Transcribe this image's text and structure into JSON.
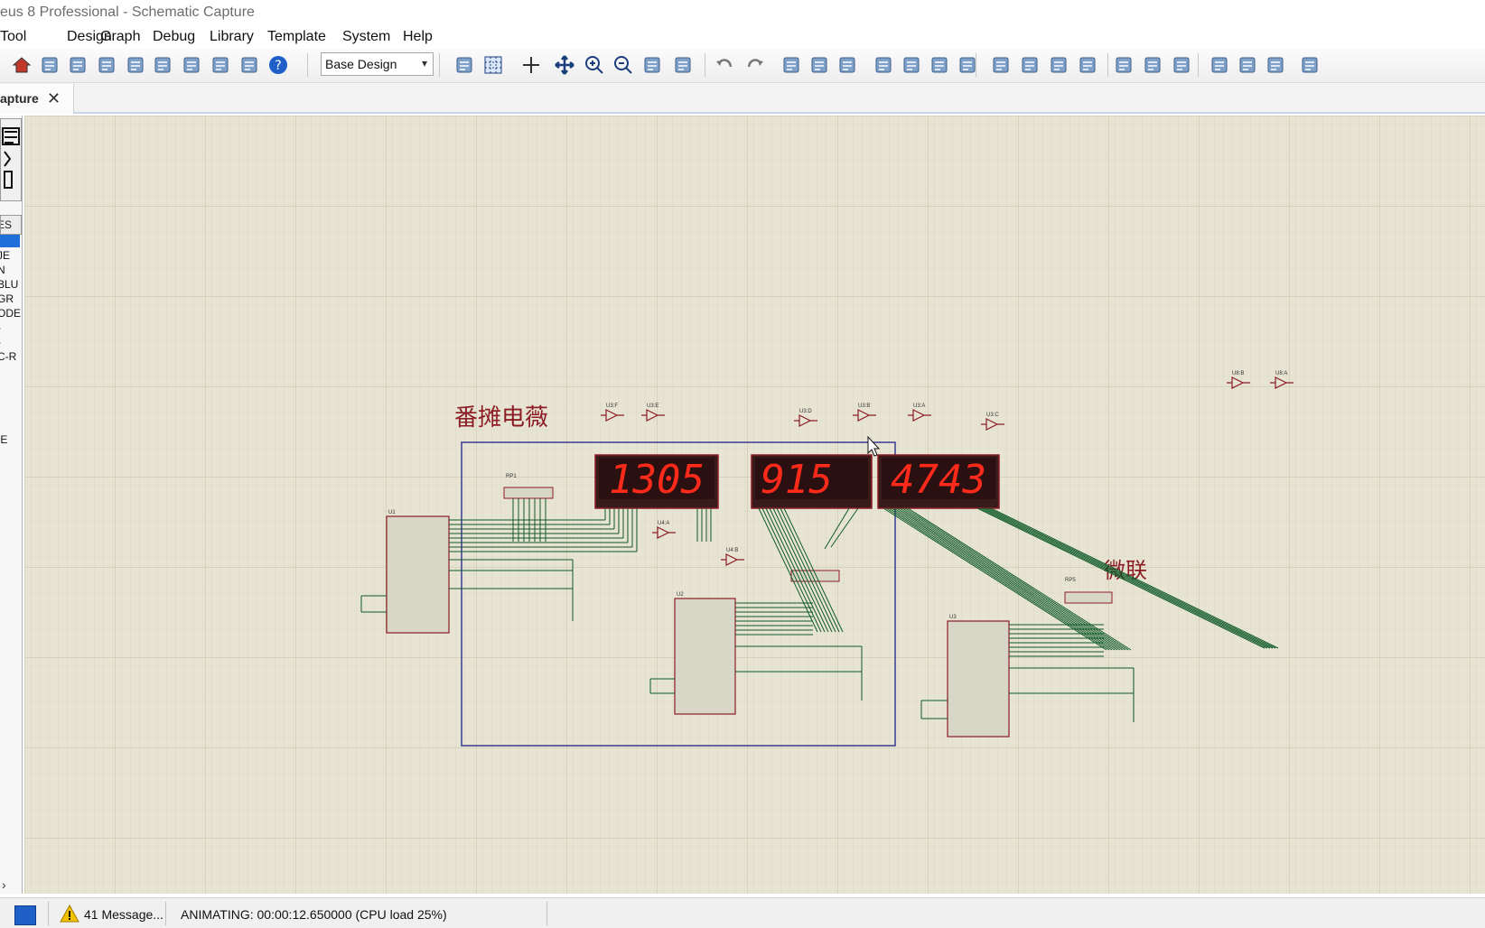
{
  "window": {
    "title": "eus 8 Professional - Schematic Capture"
  },
  "menu": {
    "items": [
      "Tool",
      "Design",
      "Graph",
      "Debug",
      "Library",
      "Template",
      "System",
      "Help"
    ]
  },
  "toolbar": {
    "layer_value": "Base Design",
    "icons": [
      "home-icon",
      "schematic-icon",
      "pcb-icon",
      "gerber-icon",
      "3d-viewer-icon",
      "bom-icon",
      "design-explorer-icon",
      "vsm-studio-icon",
      "notes-icon",
      "help-icon",
      "refresh-icon",
      "grid-icon",
      "origin-icon",
      "pan-icon",
      "zoom-in-icon",
      "zoom-out-icon",
      "zoom-all-icon",
      "zoom-area-icon",
      "undo-icon",
      "redo-icon",
      "cut-icon",
      "copy-icon",
      "paste-icon",
      "block-copy-icon",
      "block-move-icon",
      "block-rotate-icon",
      "block-delete-icon",
      "pick-device-icon",
      "make-device-icon",
      "packaging-tool-icon",
      "decompose-icon",
      "wire-autorouter-icon",
      "search-tag-icon",
      "property-assign-icon",
      "new-sheet-icon",
      "remove-sheet-icon",
      "exit-parent-icon",
      "electrical-rule-check-icon"
    ]
  },
  "tab": {
    "label": "apture",
    "close": "✕"
  },
  "left_panel": {
    "header": "ES",
    "items": [
      "JE",
      "N",
      "BLU",
      "GR",
      "ODE",
      "-",
      "-",
      "C-R",
      "IE"
    ],
    "scroll_arrow": "›"
  },
  "schematic": {
    "label_left": "番摊电薇",
    "label_right": "微联",
    "displays": [
      {
        "digits": "1305"
      },
      {
        "digits": "915"
      },
      {
        "digits": "4743"
      }
    ],
    "chip_labels": [
      "U1",
      "U2",
      "U3"
    ],
    "rp_labels": [
      "RP1",
      "RP5"
    ],
    "gate_labels": [
      "U3:F",
      "U3:E",
      "U3:D",
      "U3:B",
      "U3:A",
      "U3:C",
      "U4:A",
      "U4:B",
      "U8:B",
      "U8:A"
    ]
  },
  "status": {
    "messages": "41 Message...",
    "text": "ANIMATING: 00:00:12.650000 (CPU load 25%)"
  },
  "colors": {
    "canvas": "#e7e4d3",
    "grid": "#cfcbb6",
    "wire": "#0f5a28",
    "component": "#8c1c24",
    "segment_on": "#ff2a1a",
    "selection_box": "#2b2f8f"
  }
}
